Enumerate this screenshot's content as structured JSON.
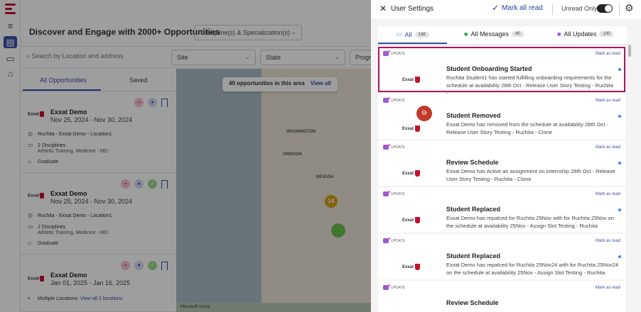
{
  "app": {
    "title": "Discover and Engage with 2000+ Opportunities",
    "discipline_placeholder": "Discipline(s) & Specialization(s)",
    "location_search": "Search by Location and address",
    "filters": [
      "Site",
      "State",
      "Progra"
    ],
    "tabs": [
      "All Opportunities",
      "Saved"
    ],
    "map_pill": "40 opportunities in this area",
    "map_pill_link": "View all",
    "map_labels": [
      "WASHINGTON",
      "OREGON",
      "NEVADA"
    ],
    "cluster_count": "14",
    "map_credit": "Microsoft Azure",
    "opportunities": [
      {
        "name": "Exxat Demo",
        "dates": "Nov 25, 2024 - Nov 30, 2024",
        "location": "Ruchita - Exxat Demo - Location1",
        "disciplines": "2 Disciplines",
        "specialties": "Athletic Training, Medicine - MD",
        "level": "Graduate"
      },
      {
        "name": "Exxat Demo",
        "dates": "Nov 25, 2024 - Nov 30, 2024",
        "location": "Ruchita - Exxat Demo - Location1",
        "disciplines": "2 Disciplines",
        "specialties": "Athletic Training, Medicine - MD",
        "level": "Graduate"
      },
      {
        "name": "Exxat Demo",
        "dates": "Jan 01, 2025 - Jan 16, 2025",
        "location": "Multiple Locations",
        "location_link": "View all 2 locations"
      }
    ],
    "logo_text": "Exxat"
  },
  "panel": {
    "title": "User Settings",
    "mark_all": "Mark all read",
    "unread_only": "Unread Only",
    "tabs": [
      {
        "label": "All",
        "count": "148"
      },
      {
        "label": "All Messages",
        "count": "40"
      },
      {
        "label": "All Updates",
        "count": "100"
      }
    ],
    "update_tag": "UPDATE",
    "mark_as_read": "Mark as read",
    "notifications": [
      {
        "title": "Student Onboarding Started",
        "body": "Ruchita Student1 has started fulfilling onboarding requirements for the schedule at availability 28th Oct - Release User Story Testing - Ruchita -...",
        "logo": "Exxat"
      },
      {
        "title": "Student Removed",
        "body": "Exxat Demo has removed from the schedule at availability 28th Oct - Release User Story Testing - Ruchita - Clone",
        "logo": "Exxat"
      },
      {
        "title": "Review Schedule",
        "body": "Exxat Demo has Active an assignment on internship 28th Oct - Release User Story Testing - Ruchita - Clone",
        "logo": "Exxat"
      },
      {
        "title": "Student Replaced",
        "body": "Exxat Demo has repalced for Ruchita 25Nov with for Ruchita 25Nov on the schedule at availability 25Nov - Assign Slot Testing - Ruchita",
        "logo": "Exxat"
      },
      {
        "title": "Student Replaced",
        "body": "Exxat Demo has repalced for Ruchita 25Nov24 with for Ruchita 25Nov24 on the schedule at availability 25Nov - Assign Slot Testing - Ruchita",
        "logo": "Exxat"
      },
      {
        "title": "Review Schedule",
        "body": "",
        "logo": "Exxat"
      }
    ]
  },
  "colors": {
    "accent": "#3b4ea8",
    "brand": "#c8102e",
    "selected_outline": "#b0145e",
    "unread_dot": "#3b82f6"
  },
  "icons": [
    "close-icon",
    "check-icon",
    "gear-icon",
    "menu-icon",
    "bookmark-icon",
    "pin-icon",
    "book-icon",
    "grad-cap-icon",
    "user-remove-icon"
  ]
}
